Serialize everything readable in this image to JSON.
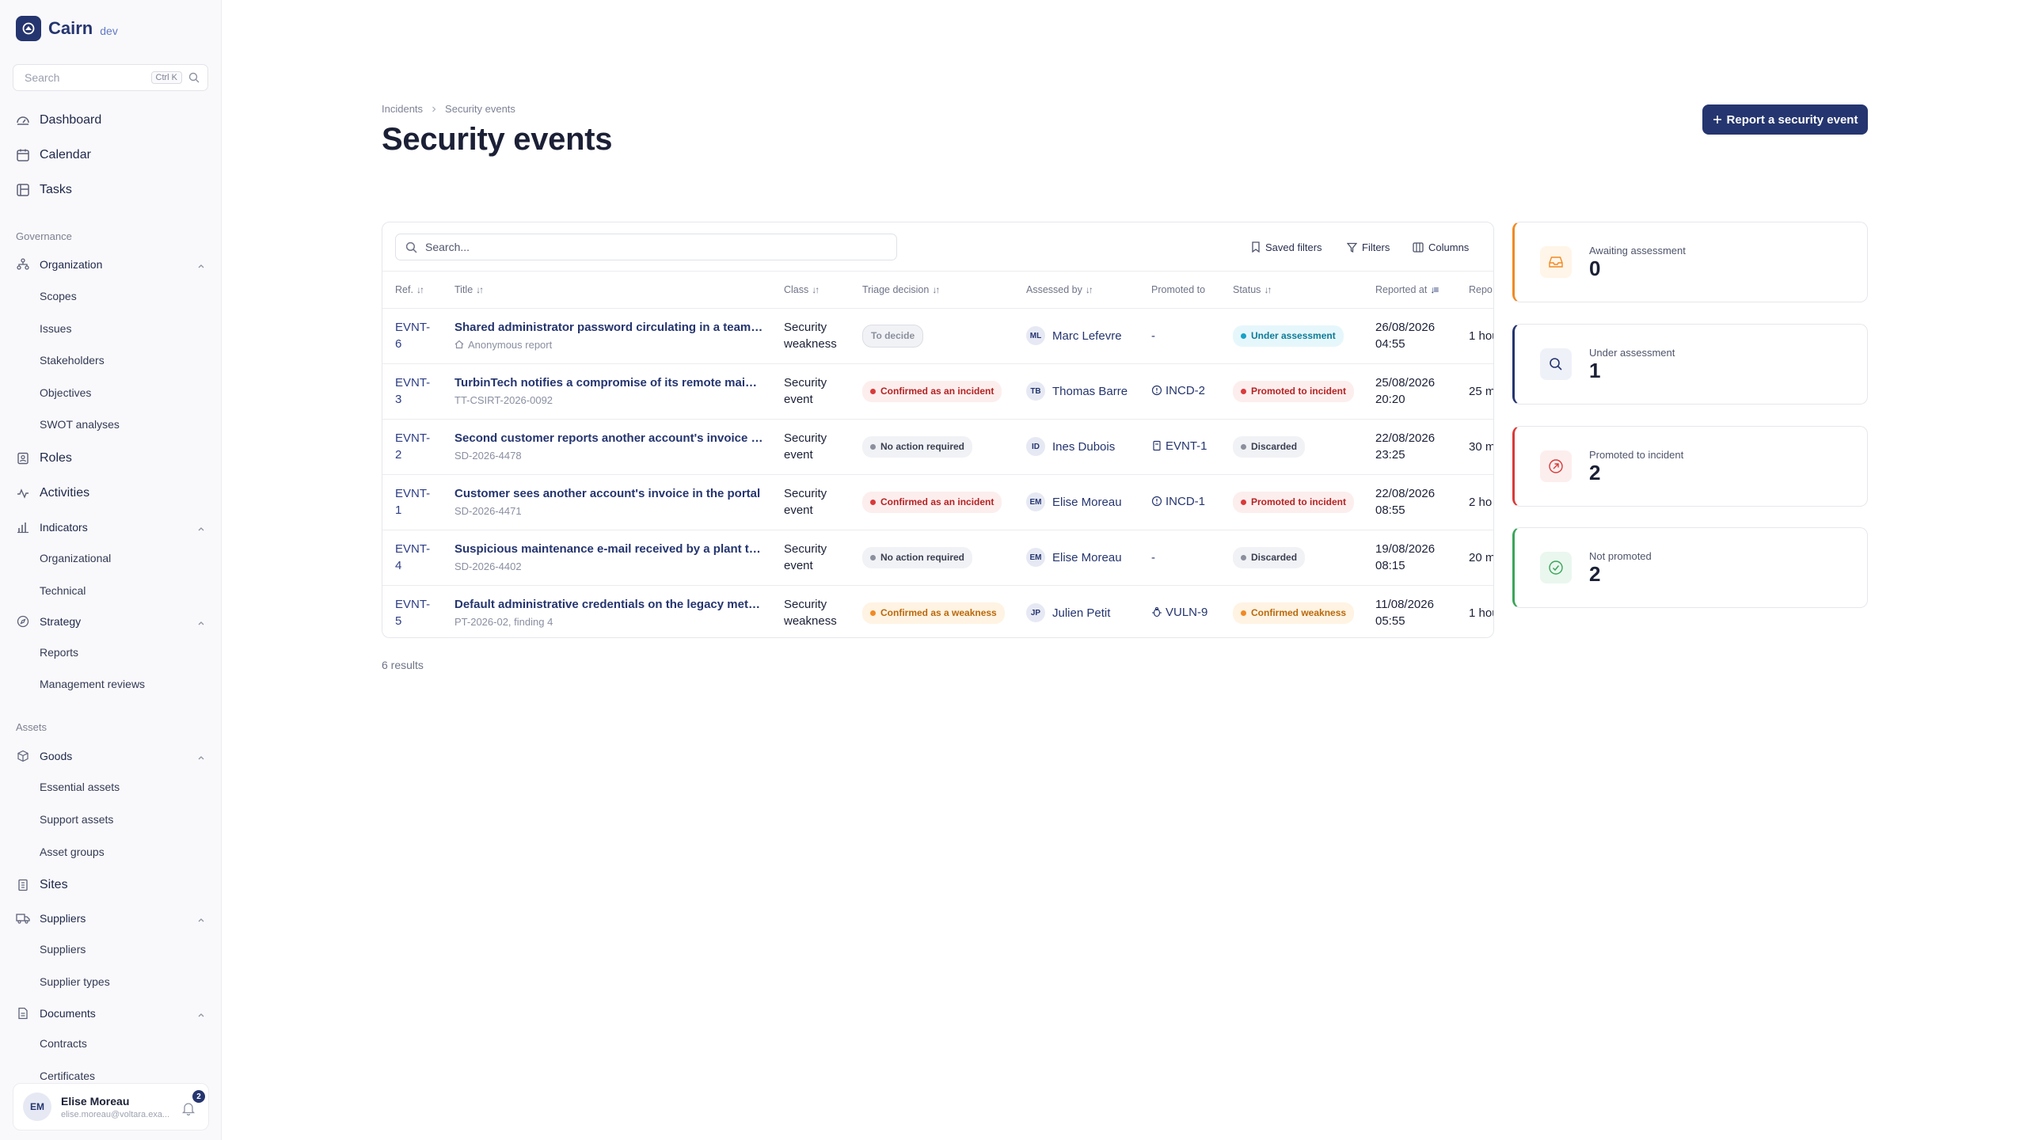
{
  "app": {
    "name": "Cairn",
    "env": "dev"
  },
  "sidebar": {
    "search_placeholder": "Search",
    "search_shortcut": "Ctrl K",
    "top_items": [
      {
        "label": "Dashboard",
        "icon": "dashboard-icon"
      },
      {
        "label": "Calendar",
        "icon": "calendar-icon"
      },
      {
        "label": "Tasks",
        "icon": "tasks-icon"
      }
    ],
    "sections": {
      "governance": "Governance",
      "assets": "Assets"
    },
    "organization": {
      "label": "Organization",
      "items": [
        "Scopes",
        "Issues",
        "Stakeholders",
        "Objectives",
        "SWOT analyses"
      ]
    },
    "roles": "Roles",
    "activities": "Activities",
    "indicators": {
      "label": "Indicators",
      "items": [
        "Organizational",
        "Technical"
      ]
    },
    "strategy": {
      "label": "Strategy",
      "items": [
        "Reports",
        "Management reviews"
      ]
    },
    "goods": {
      "label": "Goods",
      "items": [
        "Essential assets",
        "Support assets",
        "Asset groups"
      ]
    },
    "sites": "Sites",
    "suppliers": {
      "label": "Suppliers",
      "items": [
        "Suppliers",
        "Supplier types"
      ]
    },
    "documents": {
      "label": "Documents",
      "items": [
        "Contracts",
        "Certificates"
      ]
    },
    "user": {
      "initials": "EM",
      "name": "Elise Moreau",
      "email": "elise.moreau@voltara.exa...",
      "notifications": "2"
    }
  },
  "page": {
    "breadcrumb": [
      "Incidents",
      "Security events"
    ],
    "title": "Security events",
    "primary_action": "Report a security event",
    "search_placeholder": "Search...",
    "toolbar": {
      "saved_filters": "Saved filters",
      "filters": "Filters",
      "columns": "Columns"
    },
    "results": "6 results"
  },
  "table": {
    "columns": [
      "Ref.",
      "Title",
      "Class",
      "Triage decision",
      "Assessed by",
      "Promoted to",
      "Status",
      "Reported at",
      "Repo"
    ],
    "rows": [
      {
        "ref": "EVNT-6",
        "title": "Shared administrator password circulating in a team c...",
        "sub": "Anonymous report",
        "sub_icon": "anonymous-icon",
        "class": "Security weakness",
        "triage": "To decide",
        "triage_tone": "neutral",
        "assessor_initials": "ML",
        "assessor": "Marc Lefevre",
        "promoted": "-",
        "promoted_icon": "",
        "status": "Under assessment",
        "status_tone": "cyan",
        "reported": "26/08/2026 04:55",
        "repo": "1 hou"
      },
      {
        "ref": "EVNT-3",
        "title": "TurbinTech notifies a compromise of its remote mainte...",
        "sub": "TT-CSIRT-2026-0092",
        "sub_icon": "",
        "class": "Security event",
        "triage": "Confirmed as an incident",
        "triage_tone": "red",
        "assessor_initials": "TB",
        "assessor": "Thomas Barre",
        "promoted": "INCD-2",
        "promoted_icon": "incident-icon",
        "status": "Promoted to incident",
        "status_tone": "red",
        "reported": "25/08/2026 20:20",
        "repo": "25 m"
      },
      {
        "ref": "EVNT-2",
        "title": "Second customer reports another account's invoice in...",
        "sub": "SD-2026-4478",
        "sub_icon": "",
        "class": "Security event",
        "triage": "No action required",
        "triage_tone": "grey",
        "assessor_initials": "ID",
        "assessor": "Ines Dubois",
        "promoted": "EVNT-1",
        "promoted_icon": "event-icon",
        "status": "Discarded",
        "status_tone": "grey",
        "reported": "22/08/2026 23:25",
        "repo": "30 m"
      },
      {
        "ref": "EVNT-1",
        "title": "Customer sees another account's invoice in the portal",
        "sub": "SD-2026-4471",
        "sub_icon": "",
        "class": "Security event",
        "triage": "Confirmed as an incident",
        "triage_tone": "red",
        "assessor_initials": "EM",
        "assessor": "Elise Moreau",
        "promoted": "INCD-1",
        "promoted_icon": "incident-icon",
        "status": "Promoted to incident",
        "status_tone": "red",
        "reported": "22/08/2026 08:55",
        "repo": "2 ho"
      },
      {
        "ref": "EVNT-4",
        "title": "Suspicious maintenance e-mail received by a plant te...",
        "sub": "SD-2026-4402",
        "sub_icon": "",
        "class": "Security event",
        "triage": "No action required",
        "triage_tone": "grey",
        "assessor_initials": "EM",
        "assessor": "Elise Moreau",
        "promoted": "-",
        "promoted_icon": "",
        "status": "Discarded",
        "status_tone": "grey",
        "reported": "19/08/2026 08:15",
        "repo": "20 m"
      },
      {
        "ref": "EVNT-5",
        "title": "Default administrative credentials on the legacy meter...",
        "sub": "PT-2026-02, finding 4",
        "sub_icon": "",
        "class": "Security weakness",
        "triage": "Confirmed as a weakness",
        "triage_tone": "orange",
        "assessor_initials": "JP",
        "assessor": "Julien Petit",
        "promoted": "VULN-9",
        "promoted_icon": "vulnerability-icon",
        "status": "Confirmed weakness",
        "status_tone": "orange",
        "reported": "11/08/2026 05:55",
        "repo": "1 hou"
      }
    ]
  },
  "stats": [
    {
      "label": "Awaiting assessment",
      "value": "0",
      "icon": "inbox-icon",
      "color": "#f08a24",
      "bg": "#fff5e8"
    },
    {
      "label": "Under assessment",
      "value": "1",
      "icon": "search-icon",
      "color": "#25356f",
      "bg": "#eef1f8"
    },
    {
      "label": "Promoted to incident",
      "value": "2",
      "icon": "arrow-up-right-icon",
      "color": "#d93a3a",
      "bg": "#fdeeee"
    },
    {
      "label": "Not promoted",
      "value": "2",
      "icon": "check-circle-icon",
      "color": "#3aa55a",
      "bg": "#eaf7ee"
    }
  ],
  "colors": {
    "brand": "#25356f",
    "accent": "#6279c4"
  }
}
